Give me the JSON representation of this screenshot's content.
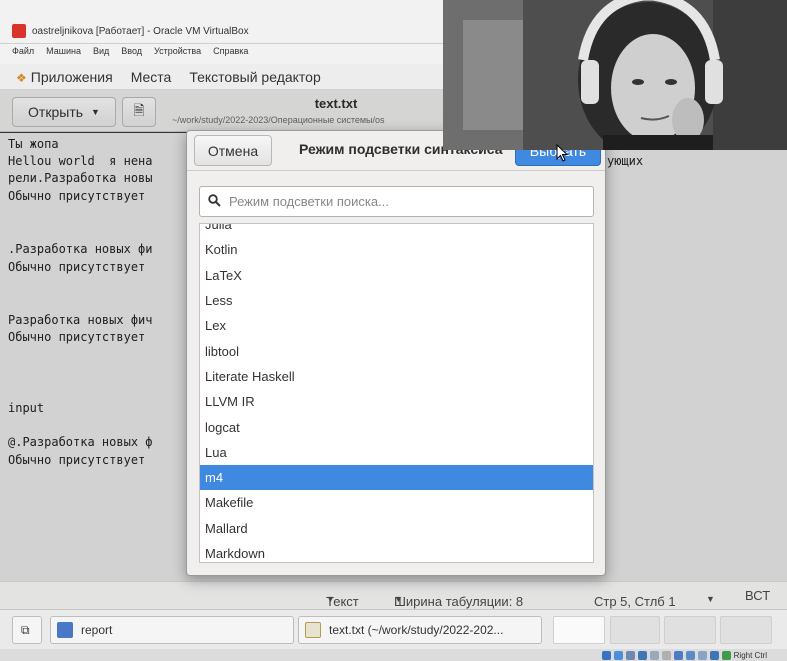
{
  "vbox": {
    "title": "oastreljnikova [Работает] - Oracle VM VirtualBox",
    "menu": [
      "Файл",
      "Машина",
      "Вид",
      "Ввод",
      "Устройства",
      "Справка"
    ],
    "status_host_key": "Right Ctrl"
  },
  "guest_panel": {
    "applications": "Приложения",
    "places": "Места",
    "app_name": "Текстовый редактор"
  },
  "gedit": {
    "open_label": "Открыть",
    "doc_title": "text.txt",
    "doc_path": "~/work/study/2022-2023/Операционные системы/os",
    "editor_lines": [
      "Ты жопа",
      "Hellou world  я нена",
      "рели.Разработка новы",
      "Обычно присутствует",
      "",
      "",
      ".Разработка новых фи",
      "Обычно присутствует",
      "",
      "",
      "Разработка новых фич",
      "Обычно присутствует",
      "",
      "",
      "",
      "input",
      "",
      "@.Разработка новых ф",
      "Обычно присутствует"
    ],
    "right_fragment": "ующих"
  },
  "statusbar": {
    "text_mode": "Текст",
    "tab_width": "Ширина табуляции: 8",
    "position": "Стр 5, Стлб 1",
    "insert_mode": "ВСТ"
  },
  "taskbar": {
    "report": "report",
    "text_window": "text.txt (~/work/study/2022-202..."
  },
  "dialog": {
    "cancel_label": "Отмена",
    "title": "Режим подсветки синтаксиса",
    "select_label": "Выбрать",
    "search_placeholder": "Режим подсветки поиска...",
    "items": [
      "Julia",
      "Kotlin",
      "LaTeX",
      "Less",
      "Lex",
      "libtool",
      "Literate Haskell",
      "LLVM IR",
      "logcat",
      "Lua",
      "m4",
      "Makefile",
      "Mallard",
      "Markdown"
    ],
    "selected": "m4"
  },
  "colors": {
    "accent": "#3f8ae0",
    "vbox_logo": "#d9342b"
  }
}
